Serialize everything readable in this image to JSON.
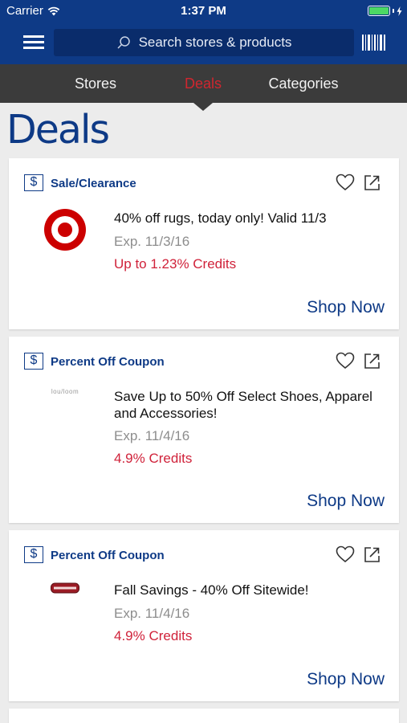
{
  "status_bar": {
    "carrier": "Carrier",
    "time": "1:37 PM",
    "battery_level": 1.0
  },
  "header": {
    "search": {
      "placeholder": "Search stores & products"
    },
    "menu_icon": "hamburger-menu-icon",
    "barcode_icon": "barcode-scanner-icon"
  },
  "tabs": [
    {
      "label": "Stores",
      "active": false
    },
    {
      "label": "Deals",
      "active": true
    },
    {
      "label": "Categories",
      "active": false
    }
  ],
  "page_title": "Deals",
  "deals": [
    {
      "type": "Sale/Clearance",
      "store_logo": "target-bullseye-logo",
      "title": "40% off rugs, today only! Valid 11/3",
      "expires": "Exp. 11/3/16",
      "credits": "Up to 1.23% Credits",
      "cta": "Shop Now"
    },
    {
      "type": "Percent Off Coupon",
      "store_logo": "store-logo-small-text",
      "logo_text": "lou/loom",
      "title": "Save Up to 50% Off Select Shoes, Apparel and Accessories!",
      "expires": "Exp. 11/4/16",
      "credits": "4.9% Credits",
      "cta": "Shop Now"
    },
    {
      "type": "Percent Off Coupon",
      "store_logo": "store-logo-red-badge",
      "title": "Fall Savings - 40% Off Sitewide!",
      "expires": "Exp. 11/4/16",
      "credits": "4.9% Credits",
      "cta": "Shop Now"
    }
  ],
  "colors": {
    "brand_blue": "#0e3a86",
    "active_tab_red": "#d0262f",
    "credits_red": "#d0223a",
    "tab_bar_bg": "#3b3b3b",
    "page_bg": "#ececec"
  }
}
